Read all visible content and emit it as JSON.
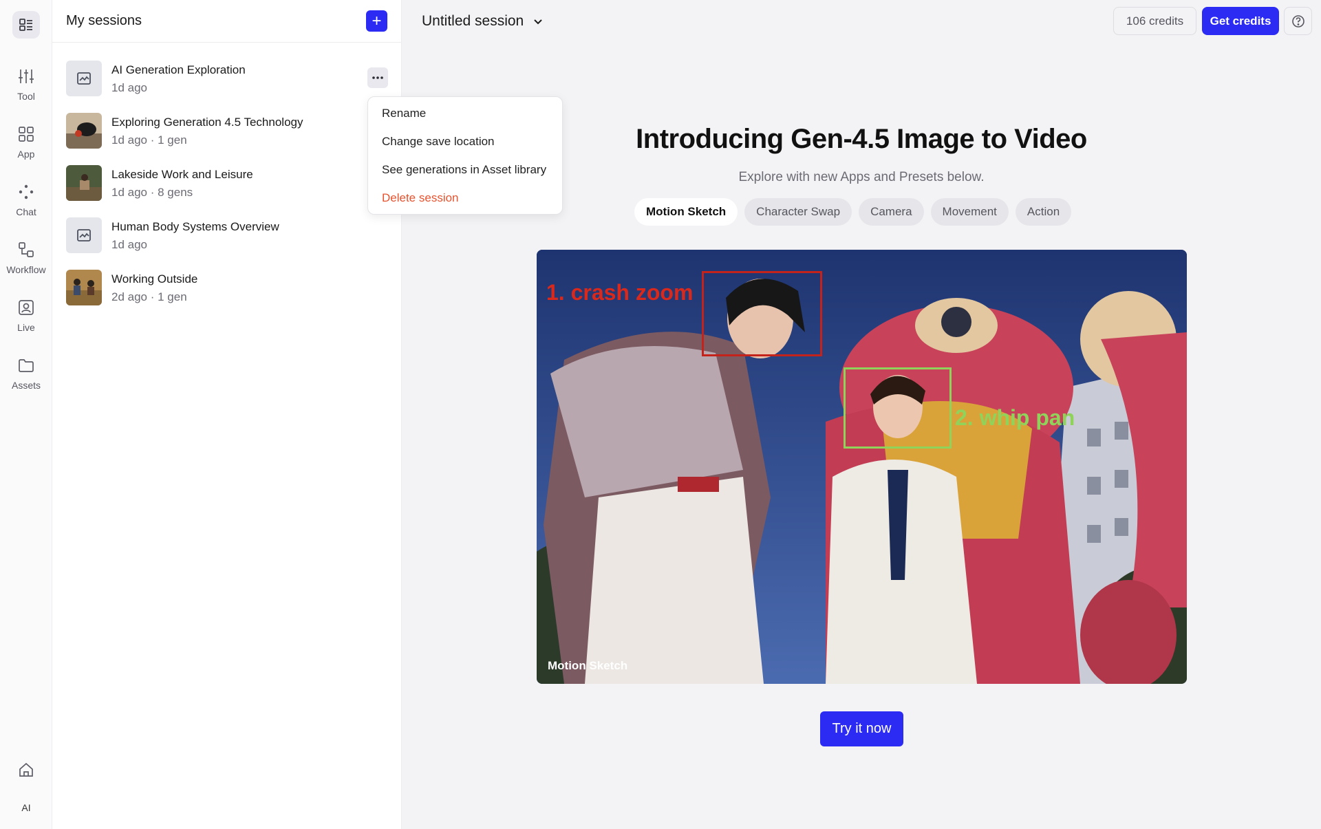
{
  "rail": {
    "items": [
      {
        "label": "Tool",
        "icon": "sliders-icon"
      },
      {
        "label": "App",
        "icon": "grid-icon"
      },
      {
        "label": "Chat",
        "icon": "chat-dots-icon"
      },
      {
        "label": "Workflow",
        "icon": "workflow-icon"
      },
      {
        "label": "Live",
        "icon": "live-icon"
      },
      {
        "label": "Assets",
        "icon": "folder-icon"
      }
    ],
    "bottom_label": "AI"
  },
  "sessions": {
    "title": "My sessions",
    "add_label": "+",
    "items": [
      {
        "title": "AI Generation Exploration",
        "meta": "1d ago"
      },
      {
        "title": "Exploring Generation 4.5 Technology",
        "meta": "1d ago · 1 gen"
      },
      {
        "title": "Lakeside Work and Leisure",
        "meta": "1d ago · 8 gens"
      },
      {
        "title": "Human Body Systems Overview",
        "meta": "1d ago"
      },
      {
        "title": "Working Outside",
        "meta": "2d ago · 1 gen"
      }
    ]
  },
  "context_menu": {
    "rename": "Rename",
    "change_location": "Change save location",
    "see_generations": "See generations in Asset library",
    "delete": "Delete session"
  },
  "header": {
    "session_name": "Untitled session",
    "credits": "106 credits",
    "get_credits": "Get credits"
  },
  "hero": {
    "title": "Introducing Gen-4.5 Image to Video",
    "subtitle": "Explore with new Apps and Presets below.",
    "pills": [
      "Motion Sketch",
      "Character Swap",
      "Camera",
      "Movement",
      "Action"
    ],
    "annotation_1": "1. crash zoom",
    "annotation_2": "2. whip pan",
    "caption": "Motion Sketch",
    "cta": "Try it now"
  },
  "colors": {
    "accent": "#2b2bf3",
    "danger": "#e5532f",
    "anno_red": "#d8291c",
    "anno_green": "#8fd35a"
  }
}
